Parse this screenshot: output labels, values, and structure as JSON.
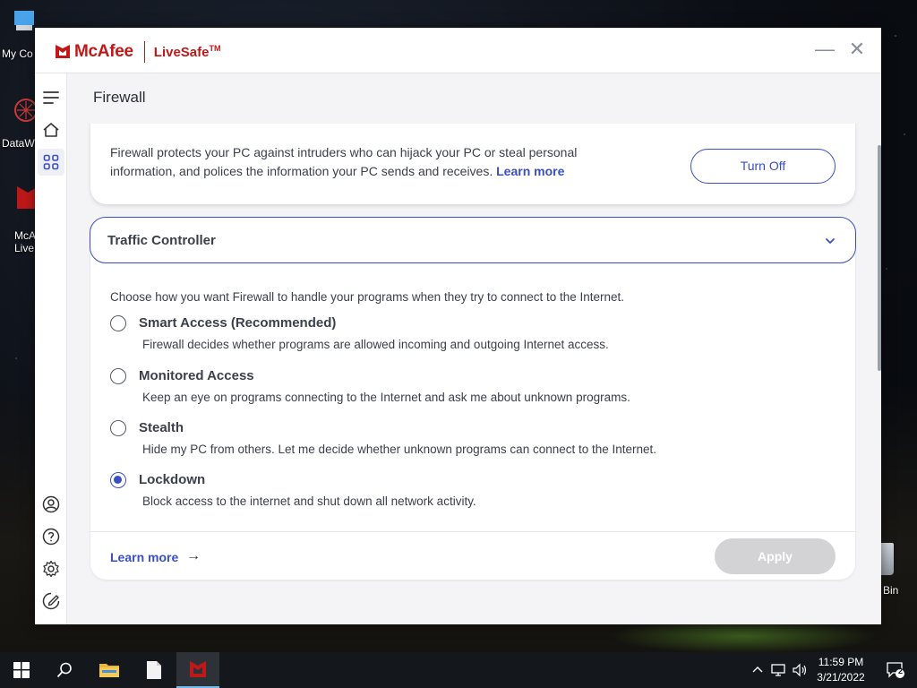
{
  "desktop": {
    "icons": [
      {
        "label": "My Co"
      },
      {
        "label": "DataW"
      },
      {
        "label": "McA\nLive"
      }
    ],
    "recycle_bin_label": "Bin"
  },
  "window": {
    "brand_name": "McAfee",
    "product_name": "LiveSafe",
    "product_tm": "TM",
    "minimize_glyph": "—",
    "close_glyph": "✕"
  },
  "page": {
    "title": "Firewall"
  },
  "firewall_card": {
    "description": "Firewall protects your PC against intruders who can hijack your PC or steal personal information, and polices the information your PC sends and receives.",
    "learn_more": "Learn more",
    "turn_off_label": "Turn Off"
  },
  "traffic_controller": {
    "title": "Traffic Controller",
    "intro": "Choose how you want Firewall to handle your programs when they try to connect to the Internet.",
    "options": [
      {
        "label": "Smart Access (Recommended)",
        "desc": "Firewall decides whether programs are allowed incoming and outgoing Internet access.",
        "checked": false
      },
      {
        "label": "Monitored Access",
        "desc": "Keep an eye on programs connecting to the Internet and ask me about unknown programs.",
        "checked": false
      },
      {
        "label": "Stealth",
        "desc": "Hide my PC from others. Let me decide whether unknown programs can connect to the Internet.",
        "checked": false
      },
      {
        "label": "Lockdown",
        "desc": "Block access to the internet and shut down all network activity.",
        "checked": true
      }
    ],
    "learn_more": "Learn more",
    "arrow": "→",
    "apply_label": "Apply"
  },
  "taskbar": {
    "time": "11:59 PM",
    "date": "3/21/2022",
    "notification_count": "2"
  },
  "colors": {
    "accent": "#3a4fc4",
    "brand_red": "#c01818"
  }
}
